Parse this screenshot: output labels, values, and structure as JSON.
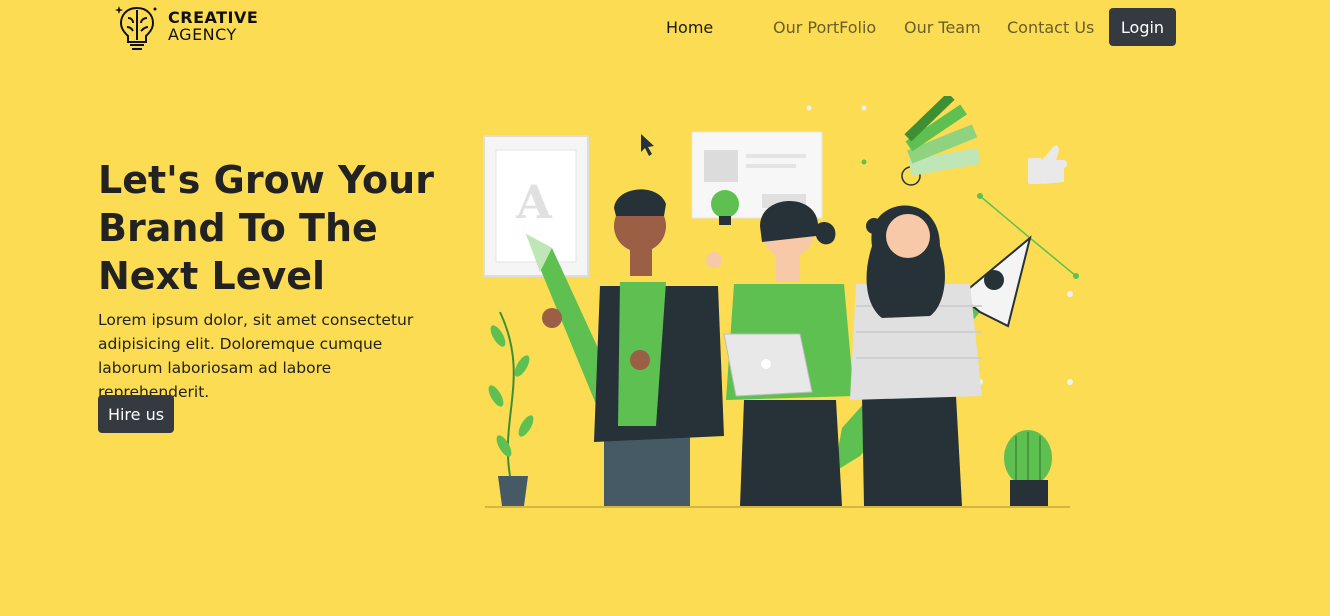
{
  "brand": {
    "line1": "CREATIVE",
    "line2": "AGENCY",
    "icon": "brain-bulb-icon"
  },
  "nav": {
    "items": [
      {
        "label": "Home",
        "active": true
      },
      {
        "label": "Our PortFolio",
        "active": false
      },
      {
        "label": "Our Team",
        "active": false
      },
      {
        "label": "Contact Us",
        "active": false
      }
    ],
    "login_label": "Login"
  },
  "hero": {
    "title_lines": [
      "Let's Grow Your",
      "Brand To The",
      "Next Level"
    ],
    "description": "Lorem ipsum dolor, sit amet consectetur adipisicing elit. Doloremque cumque laborum laboriosam ad labore reprehenderit.",
    "cta_label": "Hire us",
    "illustration_letter": "A"
  },
  "colors": {
    "background": "#fbdc53",
    "button": "#343a40",
    "accent_green": "#5fc052",
    "dark": "#263238"
  }
}
